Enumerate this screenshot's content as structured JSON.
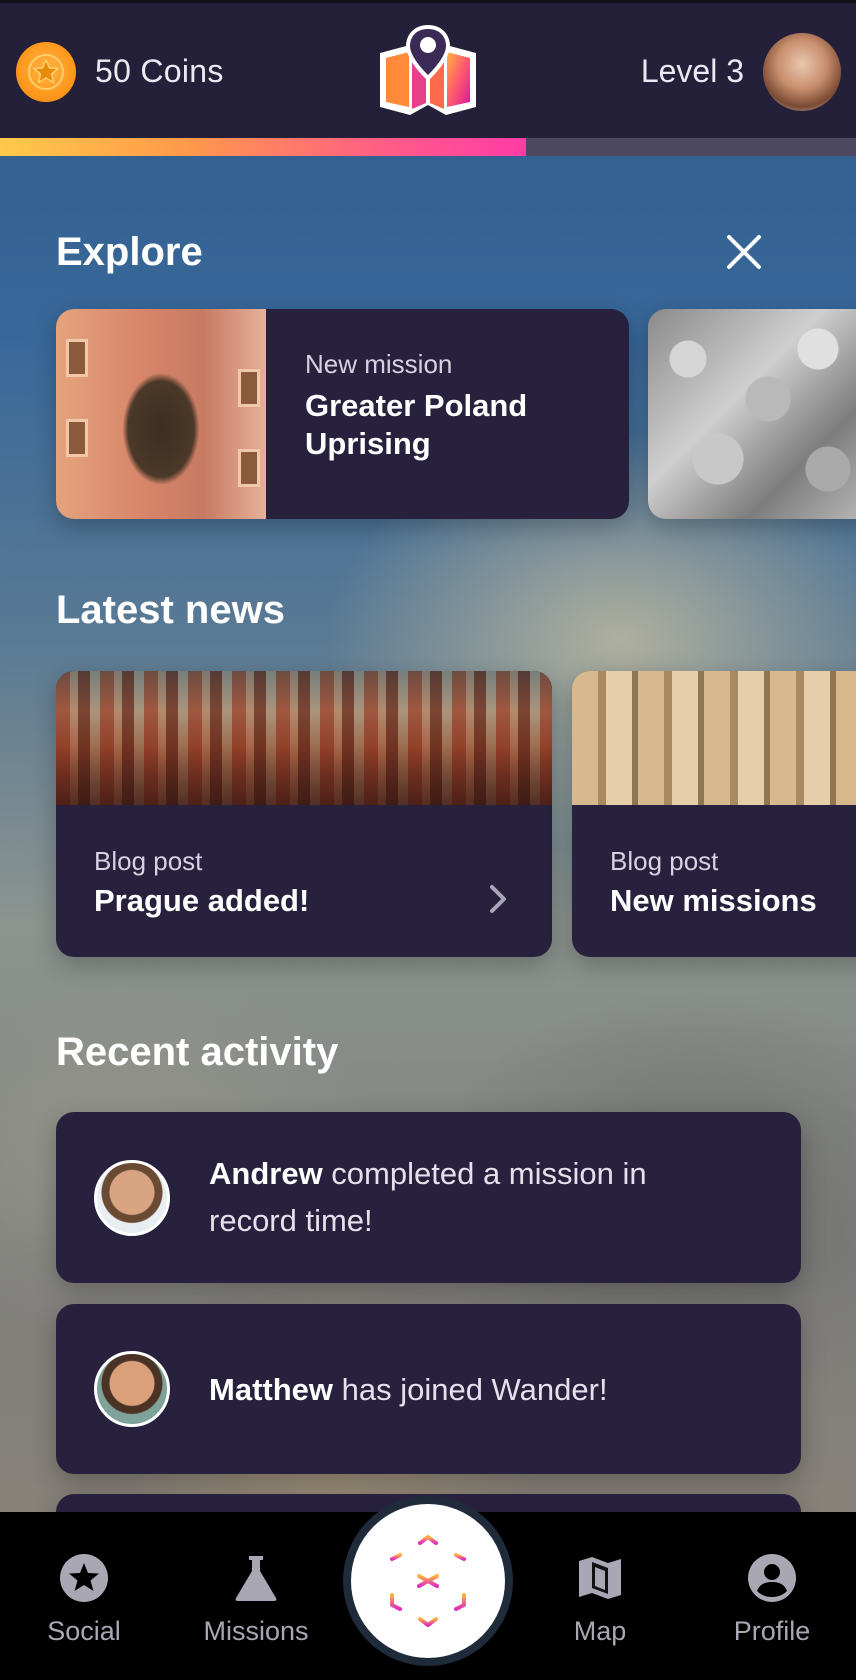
{
  "header": {
    "coins_label": "50 Coins",
    "level_label": "Level 3",
    "progress_fraction": 0.614
  },
  "explore": {
    "title": "Explore",
    "cards": [
      {
        "label": "New mission",
        "title": "Greater Poland Uprising"
      }
    ]
  },
  "news": {
    "title": "Latest news",
    "cards": [
      {
        "label": "Blog post",
        "title": "Prague added!"
      },
      {
        "label": "Blog post",
        "title": "New missions"
      }
    ]
  },
  "activity": {
    "title": "Recent activity",
    "items": [
      {
        "name": "Andrew",
        "text": " completed a mission in record time!"
      },
      {
        "name": "Matthew",
        "text": " has joined Wander!"
      }
    ]
  },
  "nav": {
    "items": [
      {
        "label": "Social",
        "icon": "star-icon"
      },
      {
        "label": "Missions",
        "icon": "flask-icon"
      },
      {
        "label": "Map",
        "icon": "map-icon"
      },
      {
        "label": "Profile",
        "icon": "profile-icon"
      }
    ],
    "center_icon": "ar-cube-icon"
  },
  "colors": {
    "header_bg": "#25203a",
    "card_bg": "#27213d",
    "progress_start": "#ffc94a",
    "progress_end": "#ff3ca6",
    "coin": "#ff9a1f"
  }
}
